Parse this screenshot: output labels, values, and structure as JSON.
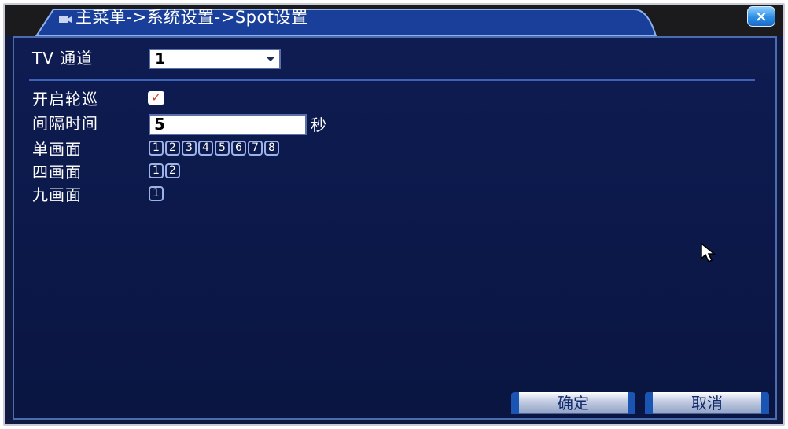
{
  "window": {
    "title": "主菜单->系统设置->Spot设置",
    "close_label": "×"
  },
  "form": {
    "tv_channel": {
      "label": "TV 通道",
      "value": "1"
    },
    "enable_tour": {
      "label": "开启轮巡",
      "checked": true,
      "checkmark": "✓"
    },
    "interval": {
      "label": "间隔时间",
      "value": "5",
      "unit": "秒"
    },
    "single": {
      "label": "单画面",
      "buttons": [
        "1",
        "2",
        "3",
        "4",
        "5",
        "6",
        "7",
        "8"
      ]
    },
    "quad": {
      "label": "四画面",
      "buttons": [
        "1",
        "2"
      ]
    },
    "nine": {
      "label": "九画面",
      "buttons": [
        "1"
      ]
    }
  },
  "footer": {
    "ok_label": "确定",
    "cancel_label": "取消"
  },
  "colors": {
    "panel": "#0e1c52",
    "accent": "#3d63b6",
    "frame": "#c9ccd6"
  }
}
